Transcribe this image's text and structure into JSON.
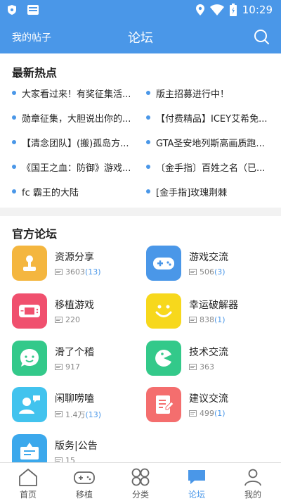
{
  "status": {
    "time": "10:29"
  },
  "appbar": {
    "my_posts": "我的帖子",
    "title": "论坛"
  },
  "hot": {
    "title": "最新热点",
    "items": [
      "大家看过来！有奖征集活...",
      "版主招募进行中！",
      "勋章征集，大胆说出你的...",
      "【付费精品】ICEY艾希免...",
      "【清念团队】(搬)孤岛方...",
      "GTA圣安地列斯高画质跑...",
      "《国王之血：防御》游戏...",
      "〔金手指〕百姓之名（已...",
      "fc 霸王的大陆",
      "[金手指]玫瑰荆棘"
    ]
  },
  "official": {
    "title": "官方论坛",
    "forums": [
      {
        "name": "资源分享",
        "count": "3603",
        "new": "(13)",
        "color": "#f4b63f",
        "icon": "joystick-icon"
      },
      {
        "name": "游戏交流",
        "count": "506",
        "new": "(3)",
        "color": "#4a97e8",
        "icon": "gamepad-icon"
      },
      {
        "name": "移植游戏",
        "count": "220",
        "new": "",
        "color": "#f0506e",
        "icon": "handheld-icon"
      },
      {
        "name": "幸运破解器",
        "count": "838",
        "new": "(1)",
        "color": "#f7d81c",
        "icon": "smiley-icon"
      },
      {
        "name": "滑了个稽",
        "count": "917",
        "new": "",
        "color": "#33c98a",
        "icon": "chat-face-icon"
      },
      {
        "name": "技术交流",
        "count": "363",
        "new": "",
        "color": "#33c98a",
        "icon": "pacman-icon"
      },
      {
        "name": "闲聊唠嗑",
        "count": "1.4万",
        "new": "(13)",
        "color": "#42c3ee",
        "icon": "person-chat-icon"
      },
      {
        "name": "建议交流",
        "count": "499",
        "new": "(1)",
        "color": "#f46e6e",
        "icon": "document-pen-icon"
      },
      {
        "name": "版务|公告",
        "count": "15",
        "new": "",
        "color": "#3ba8ec",
        "icon": "notice-board-icon"
      }
    ]
  },
  "tabs": [
    {
      "label": "首页",
      "icon": "home-icon"
    },
    {
      "label": "移植",
      "icon": "gamepad-icon"
    },
    {
      "label": "分类",
      "icon": "grid-icon"
    },
    {
      "label": "论坛",
      "icon": "forum-icon"
    },
    {
      "label": "我的",
      "icon": "profile-icon"
    }
  ]
}
